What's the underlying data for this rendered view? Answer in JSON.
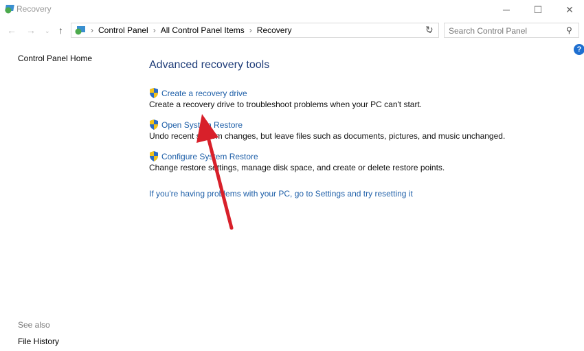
{
  "window": {
    "title": "Recovery"
  },
  "breadcrumb": [
    "Control Panel",
    "All Control Panel Items",
    "Recovery"
  ],
  "search": {
    "placeholder": "Search Control Panel"
  },
  "sidebar": {
    "home": "Control Panel Home",
    "see_also": "See also",
    "file_history": "File History"
  },
  "main": {
    "heading": "Advanced recovery tools",
    "items": [
      {
        "label": "Create a recovery drive",
        "desc": "Create a recovery drive to troubleshoot problems when your PC can't start."
      },
      {
        "label": "Open System Restore",
        "desc": "Undo recent system changes, but leave files such as documents, pictures, and music unchanged."
      },
      {
        "label": "Configure System Restore",
        "desc": "Change restore settings, manage disk space, and create or delete restore points."
      }
    ],
    "reset_link": "If you're having problems with your PC, go to Settings and try resetting it"
  },
  "colors": {
    "link": "#1e5fa8",
    "heading": "#1e3c78",
    "arrow": "#d8202a"
  }
}
